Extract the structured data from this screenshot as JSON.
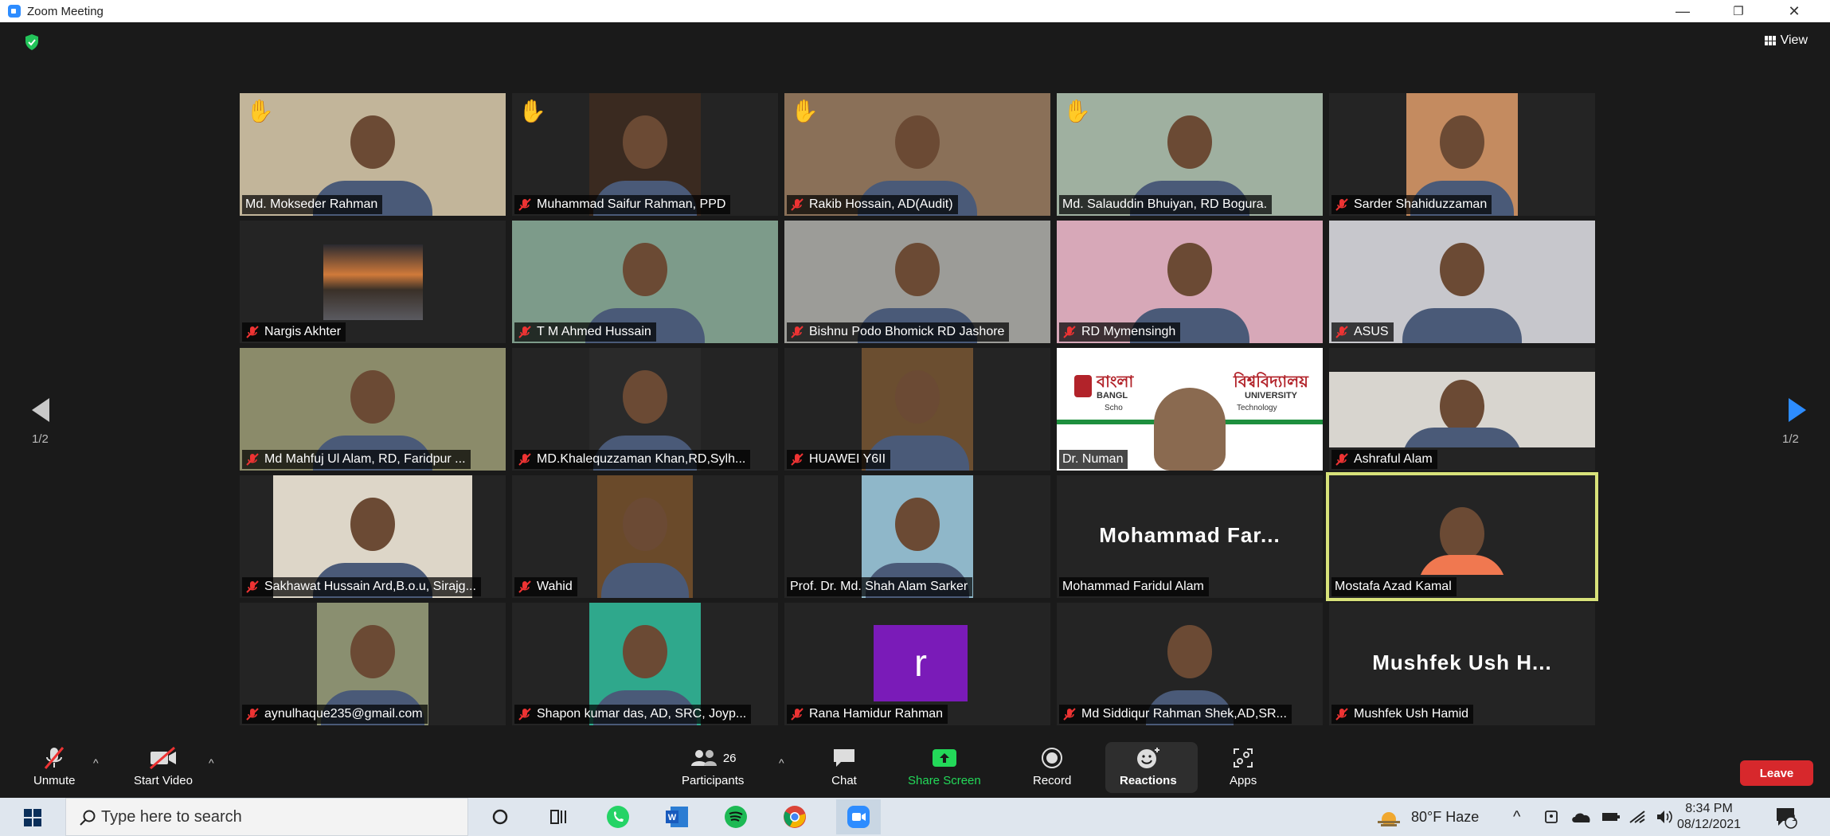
{
  "window": {
    "title": "Zoom Meeting",
    "minimize": "—",
    "restore": "❐",
    "close": "✕"
  },
  "view": {
    "label": "View"
  },
  "pagination": {
    "left": "1/2",
    "right": "1/2"
  },
  "participants_tiles": [
    {
      "name": "Md. Mokseder Rahman",
      "muted": false,
      "hand": true
    },
    {
      "name": "Muhammad Saifur Rahman, PPD",
      "muted": true,
      "hand": true
    },
    {
      "name": "Rakib Hossain, AD(Audit)",
      "muted": true,
      "hand": true
    },
    {
      "name": "Md. Salauddin Bhuiyan, RD Bogura.",
      "muted": false,
      "hand": true
    },
    {
      "name": "Sarder Shahiduzzaman",
      "muted": true,
      "hand": false
    },
    {
      "name": "Nargis Akhter",
      "muted": true,
      "hand": false
    },
    {
      "name": "T M Ahmed Hussain",
      "muted": true,
      "hand": false
    },
    {
      "name": "Bishnu Podo Bhomick RD Jashore",
      "muted": true,
      "hand": false
    },
    {
      "name": "RD Mymensingh",
      "muted": true,
      "hand": false
    },
    {
      "name": "ASUS",
      "muted": true,
      "hand": false
    },
    {
      "name": "Md Mahfuj Ul Alam, RD, Faridpur ...",
      "muted": true,
      "hand": false
    },
    {
      "name": "MD.Khalequzzaman Khan,RD,Sylh...",
      "muted": true,
      "hand": false
    },
    {
      "name": "HUAWEI Y6II",
      "muted": true,
      "hand": false
    },
    {
      "name": "Dr. Numan",
      "muted": false,
      "hand": false,
      "banner_left": "বাংলা",
      "banner_right": "বিশ্ববিদ্যালয়",
      "banner_sub_left": "BANGL",
      "banner_sub_right": "UNIVERSITY",
      "banner_sub2_left": "Scho",
      "banner_sub2_right": "Technology"
    },
    {
      "name": "Ashraful Alam",
      "muted": true,
      "hand": false
    },
    {
      "name": "Sakhawat Hussain Ard,B.o.u, Sirajg...",
      "muted": true,
      "hand": false
    },
    {
      "name": "Wahid",
      "muted": true,
      "hand": false
    },
    {
      "name": "Prof. Dr. Md. Shah Alam Sarker",
      "muted": false,
      "hand": false
    },
    {
      "name": "Mohammad Faridul Alam",
      "muted": false,
      "hand": false,
      "big": "Mohammad  Far..."
    },
    {
      "name": "Mostafa Azad Kamal",
      "muted": false,
      "hand": false,
      "active": true
    },
    {
      "name": "aynulhaque235@gmail.com",
      "muted": true,
      "hand": false
    },
    {
      "name": "Shapon kumar das, AD, SRC, Joyp...",
      "muted": true,
      "hand": false
    },
    {
      "name": "Rana Hamidur Rahman",
      "muted": true,
      "hand": false,
      "avatar_letter": "r"
    },
    {
      "name": "Md Siddiqur Rahman Shek,AD,SR...",
      "muted": true,
      "hand": false
    },
    {
      "name": "Mushfek Ush Hamid",
      "muted": true,
      "hand": false,
      "big": "Mushfek  Ush  H..."
    }
  ],
  "toolbar": {
    "unmute": "Unmute",
    "start_video": "Start Video",
    "participants": "Participants",
    "participants_count": "26",
    "chat": "Chat",
    "share_screen": "Share Screen",
    "record": "Record",
    "reactions": "Reactions",
    "apps": "Apps",
    "leave": "Leave"
  },
  "taskbar": {
    "search_placeholder": "Type here to search",
    "weather": "80°F  Haze",
    "time": "8:34 PM",
    "date": "08/12/2021",
    "notification_count": "1"
  },
  "colors": {
    "zoom_blue": "#2d8cff",
    "leave_red": "#d7282c",
    "share_green": "#23d959",
    "active_outline": "#d8e27a"
  }
}
